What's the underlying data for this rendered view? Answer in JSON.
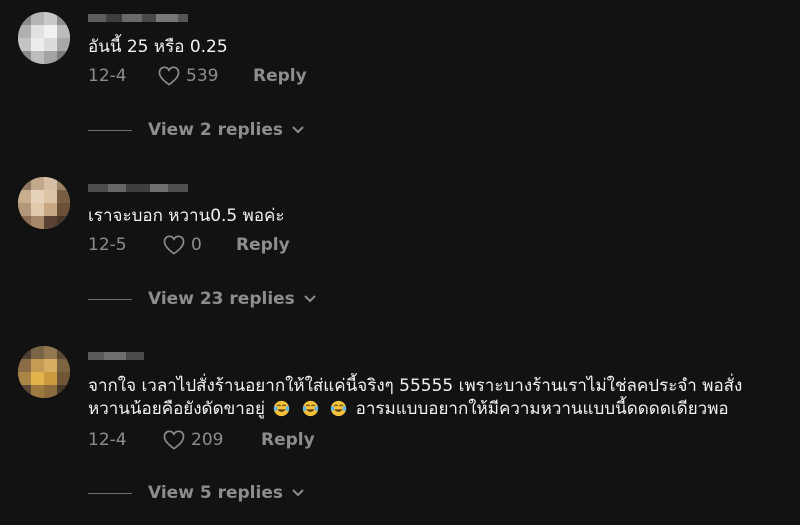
{
  "comments": [
    {
      "text": "อันนี้ 25 หรือ 0.25",
      "date": "12-4",
      "likes": "539",
      "reply_label": "Reply",
      "view_replies": "View 2 replies"
    },
    {
      "text": "เราจะบอก หวาน0.5 พอค่ะ",
      "date": "12-5",
      "likes": "0",
      "reply_label": "Reply",
      "view_replies": "View 23 replies"
    },
    {
      "text_line1": "จากใจ เวลาไปสั่งร้านอยากให้ใส่แค่นี้จริงๆ 55555 เพราะบางร้านเราไม่ใช่ลคประจำ พอสั่ง",
      "text_line2_a": "หวานน้อยคือยังดัดขาอยู่",
      "text_line2_b": "อารมแบบอยากให้มีความหวานแบบนี้ดดดดเดียวพอ",
      "emoji": "face-with-tears-of-joy-icon",
      "date": "12-4",
      "likes": "209",
      "reply_label": "Reply",
      "view_replies": "View 5 replies"
    }
  ],
  "colors": {
    "background": "#121212",
    "text": "#f2f2f2",
    "secondary": "#8d8d8d"
  }
}
